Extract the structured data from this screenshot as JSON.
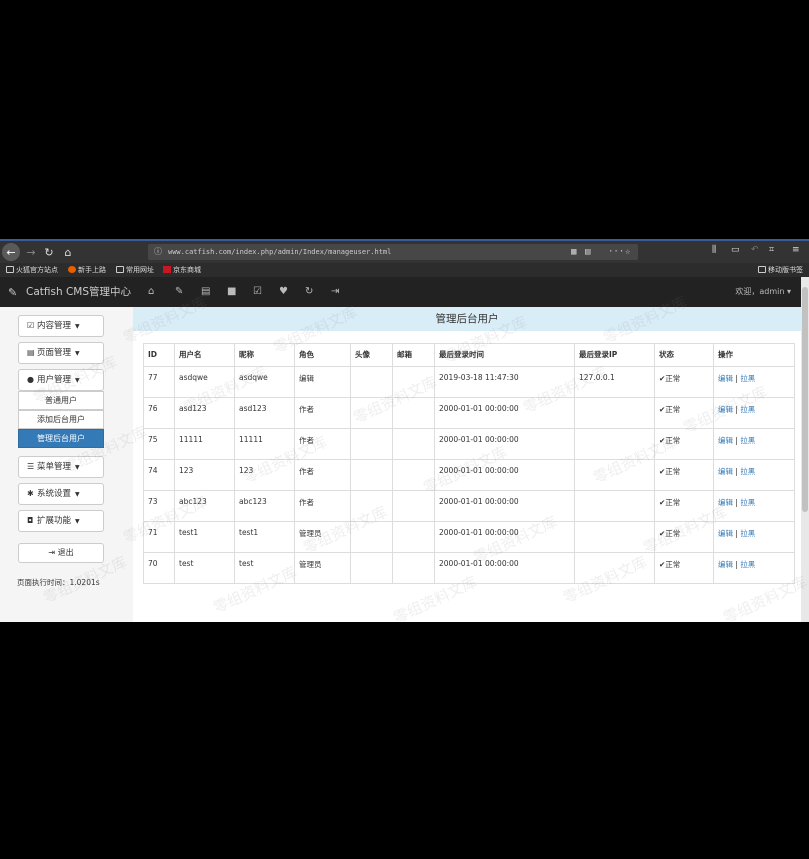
{
  "browser": {
    "url": "www.catfish.com/index.php/admin/Index/manageuser.html",
    "bookmarks": [
      "火狐官方站点",
      "新手上路",
      "常用网址",
      "京东商城"
    ],
    "mobile_bookmarks": "移动版书签"
  },
  "admin": {
    "brand": "Catfish CMS管理中心",
    "welcome": "欢迎，admin"
  },
  "sidebar": {
    "items": [
      {
        "label": "内容管理"
      },
      {
        "label": "页面管理"
      },
      {
        "label": "用户管理"
      },
      {
        "label": "菜单管理"
      },
      {
        "label": "系统设置"
      },
      {
        "label": "扩展功能"
      }
    ],
    "sub_items": [
      "普通用户",
      "添加后台用户",
      "管理后台用户"
    ],
    "logout": "退出",
    "exec_time": "页面执行时间：1.0201s"
  },
  "main": {
    "title": "管理后台用户",
    "columns": [
      "ID",
      "用户名",
      "昵称",
      "角色",
      "头像",
      "邮箱",
      "最后登录时间",
      "最后登录IP",
      "状态",
      "操作"
    ],
    "rows": [
      {
        "id": "77",
        "username": "asdqwe",
        "nickname": "asdqwe",
        "role": "编辑",
        "time": "2019-03-18 11:47:30",
        "ip": "127.0.0.1",
        "status": "正常"
      },
      {
        "id": "76",
        "username": "asd123",
        "nickname": "asd123",
        "role": "作者",
        "time": "2000-01-01 00:00:00",
        "ip": "",
        "status": "正常"
      },
      {
        "id": "75",
        "username": "11111",
        "nickname": "11111",
        "role": "作者",
        "time": "2000-01-01 00:00:00",
        "ip": "",
        "status": "正常"
      },
      {
        "id": "74",
        "username": "123",
        "nickname": "123",
        "role": "作者",
        "time": "2000-01-01 00:00:00",
        "ip": "",
        "status": "正常"
      },
      {
        "id": "73",
        "username": "abc123",
        "nickname": "abc123",
        "role": "作者",
        "time": "2000-01-01 00:00:00",
        "ip": "",
        "status": "正常"
      },
      {
        "id": "71",
        "username": "test1",
        "nickname": "test1",
        "role": "管理员",
        "time": "2000-01-01 00:00:00",
        "ip": "",
        "status": "正常"
      },
      {
        "id": "70",
        "username": "test",
        "nickname": "test",
        "role": "管理员",
        "time": "2000-01-01 00:00:00",
        "ip": "",
        "status": "正常"
      }
    ],
    "op_edit": "编辑",
    "op_sep": "|",
    "op_block": "拉黑"
  },
  "watermark": "零组资料文库"
}
